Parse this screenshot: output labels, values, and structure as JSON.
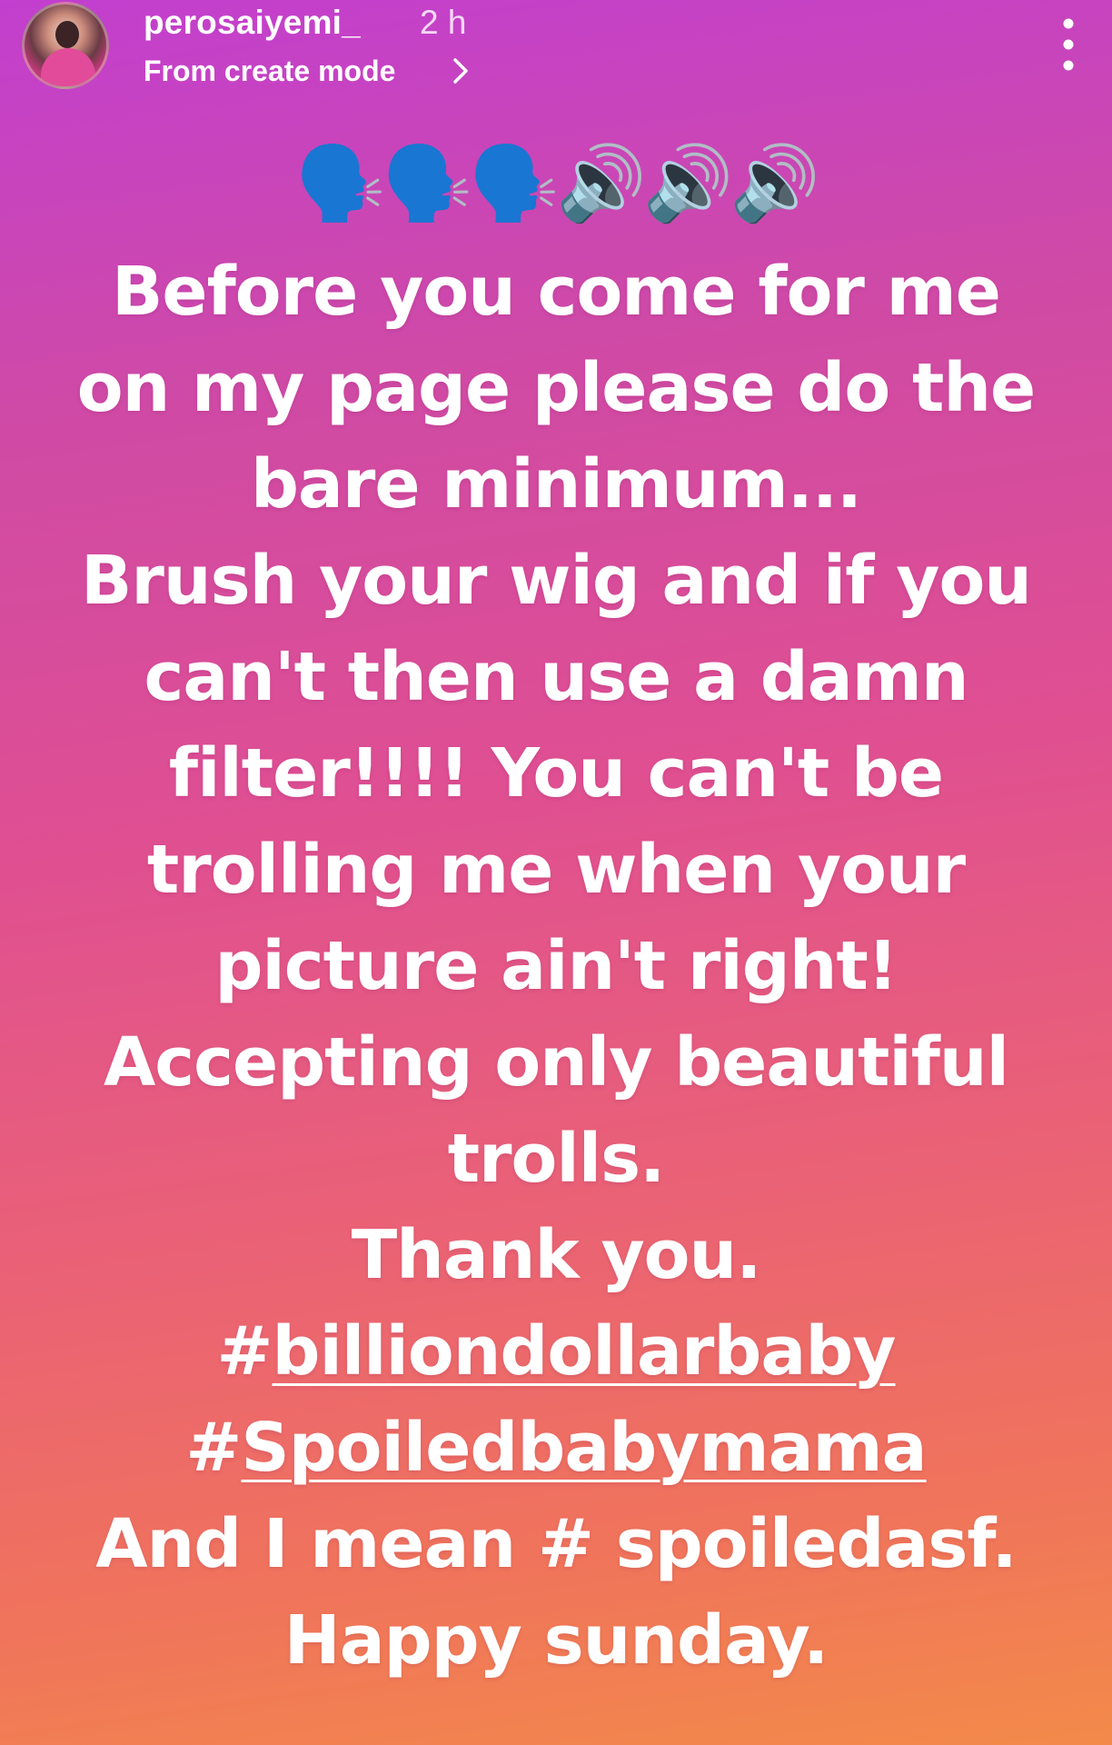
{
  "story": {
    "username": "perosaiyemi_",
    "time_ago": "2 h",
    "subtitle": "From create mode",
    "emojis": "🗣️🗣️🗣️🔊🔊🔊",
    "lines": [
      "Before you come for me",
      "on my page please do the",
      "bare minimum...",
      "Brush your wig and if you",
      "can't then use a damn",
      "filter!!!! You can't be",
      "trolling me when your",
      "picture ain't right!",
      "Accepting only beautiful",
      "trolls.",
      "Thank you."
    ],
    "hashtag_prefix": "#",
    "hashtags": [
      "billiondollarbaby",
      "Spoiledbabymama"
    ],
    "closing_lines": [
      "And I mean # spoiledasf.",
      "Happy sunday."
    ]
  },
  "colors": {
    "gradient_top": "#c23fcf",
    "gradient_bottom": "#f38a4a",
    "text": "#ffffff"
  },
  "icons": {
    "chevron": "chevron-right-icon",
    "more": "more-vertical-icon"
  }
}
